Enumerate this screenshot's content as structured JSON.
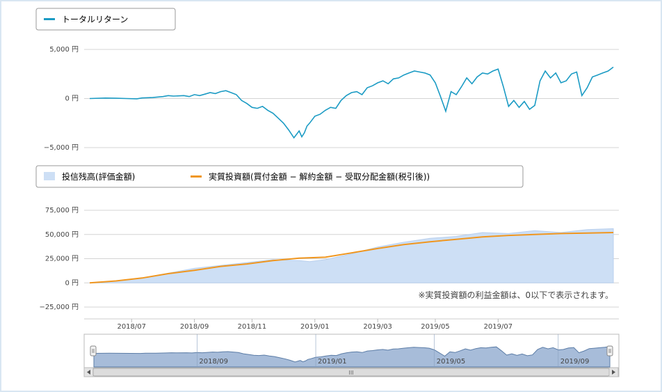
{
  "colors": {
    "return_line": "#1b9bc4",
    "balance_fill": "#cddff5",
    "balance_line": "#b8cfee",
    "invest_line": "#f0961e",
    "navigator_fill": "#a7bcd9",
    "navigator_line": "#5b7ca6",
    "grid": "#d4d4d4"
  },
  "chart_data": [
    {
      "type": "line",
      "legend": [
        "トータルリターン"
      ],
      "ylim": [
        -5000,
        5000
      ],
      "yticks": [
        "5,000 円",
        "0 円",
        "−5,000 円"
      ],
      "ytick_values": [
        5000,
        0,
        -5000
      ],
      "grid": true,
      "legend_position": "top-left",
      "series": [
        {
          "name": "トータルリターン",
          "x": [
            0,
            0.03,
            0.05,
            0.07,
            0.09,
            0.1,
            0.12,
            0.14,
            0.15,
            0.16,
            0.18,
            0.19,
            0.2,
            0.21,
            0.22,
            0.23,
            0.24,
            0.25,
            0.26,
            0.27,
            0.28,
            0.29,
            0.3,
            0.31,
            0.32,
            0.33,
            0.34,
            0.35,
            0.36,
            0.37,
            0.38,
            0.39,
            0.4,
            0.405,
            0.41,
            0.415,
            0.42,
            0.43,
            0.44,
            0.45,
            0.46,
            0.47,
            0.48,
            0.49,
            0.5,
            0.51,
            0.52,
            0.53,
            0.54,
            0.55,
            0.56,
            0.57,
            0.58,
            0.59,
            0.6,
            0.61,
            0.62,
            0.63,
            0.64,
            0.65,
            0.66,
            0.67,
            0.68,
            0.69,
            0.7,
            0.71,
            0.72,
            0.73,
            0.74,
            0.75,
            0.76,
            0.77,
            0.78,
            0.79,
            0.8,
            0.81,
            0.82,
            0.83,
            0.84,
            0.85,
            0.86,
            0.87,
            0.88,
            0.89,
            0.9,
            0.91,
            0.92,
            0.93,
            0.94,
            0.95,
            0.96,
            0.97,
            0.98,
            0.99,
            1.0
          ],
          "y": [
            0,
            50,
            30,
            0,
            -30,
            60,
            100,
            200,
            300,
            250,
            300,
            200,
            400,
            300,
            450,
            600,
            500,
            700,
            800,
            600,
            400,
            -200,
            -500,
            -900,
            -1000,
            -800,
            -1200,
            -1500,
            -2000,
            -2500,
            -3200,
            -4000,
            -3300,
            -3900,
            -3500,
            -2800,
            -2500,
            -1800,
            -1600,
            -1200,
            -900,
            -1000,
            -200,
            300,
            600,
            700,
            400,
            1100,
            1300,
            1600,
            1800,
            1500,
            2000,
            2100,
            2400,
            2600,
            2800,
            2700,
            2600,
            2400,
            1600,
            200,
            -1300,
            700,
            400,
            1200,
            2100,
            1500,
            2200,
            2600,
            2500,
            2800,
            3000,
            1200,
            -800,
            -200,
            -900,
            -300,
            -1100,
            -700,
            1800,
            2800,
            2100,
            2600,
            1600,
            1800,
            2500,
            2700,
            300,
            1100,
            2200,
            2400,
            2600,
            2800,
            3200
          ]
        }
      ]
    },
    {
      "type": "area",
      "legend": [
        "投信残高(評価金額)",
        "実質投資額(買付金額 − 解約金額 − 受取分配金額(税引後))"
      ],
      "ylim": [
        -25000,
        75000
      ],
      "yticks": [
        "75,000 円",
        "50,000 円",
        "25,000 円",
        "0 円",
        "−25,000 円"
      ],
      "ytick_values": [
        75000,
        50000,
        25000,
        0,
        -25000
      ],
      "xticks": [
        "2018/07",
        "2018/09",
        "2018/11",
        "2019/01",
        "2019/03",
        "2019/05",
        "2019/07"
      ],
      "xtick_positions": [
        0.08,
        0.2,
        0.31,
        0.43,
        0.55,
        0.66,
        0.78
      ],
      "note": "※実質投資額の利益金額は、0以下で表示されます。",
      "grid": true,
      "series": [
        {
          "name": "投信残高(評価金額)",
          "x": [
            0,
            0.05,
            0.1,
            0.15,
            0.2,
            0.25,
            0.3,
            0.35,
            0.4,
            0.42,
            0.45,
            0.5,
            0.55,
            0.6,
            0.65,
            0.7,
            0.75,
            0.8,
            0.85,
            0.9,
            0.95,
            1.0
          ],
          "y": [
            0,
            1800,
            5000,
            10000,
            15000,
            18000,
            21000,
            24000,
            23000,
            22000,
            24000,
            30000,
            37000,
            42000,
            46000,
            48000,
            52000,
            51000,
            54000,
            52000,
            55000,
            56000
          ]
        },
        {
          "name": "実質投資額(買付金額 − 解約金額 − 受取分配金額(税引後))",
          "x": [
            0,
            0.05,
            0.1,
            0.15,
            0.2,
            0.25,
            0.3,
            0.35,
            0.4,
            0.45,
            0.5,
            0.55,
            0.6,
            0.65,
            0.7,
            0.75,
            0.8,
            0.85,
            0.9,
            0.95,
            1.0
          ],
          "y": [
            0,
            2000,
            5000,
            9500,
            13000,
            17000,
            19500,
            23000,
            25500,
            26500,
            31000,
            35500,
            39500,
            42500,
            45000,
            47500,
            49000,
            50000,
            51000,
            51500,
            52000
          ]
        }
      ]
    },
    {
      "type": "area",
      "role": "navigator",
      "xticks": [
        "2018/09",
        "2019/01",
        "2019/05",
        "2019/09"
      ],
      "xtick_positions": [
        0.2,
        0.43,
        0.66,
        0.9
      ],
      "scrollbar_label": "III"
    }
  ]
}
